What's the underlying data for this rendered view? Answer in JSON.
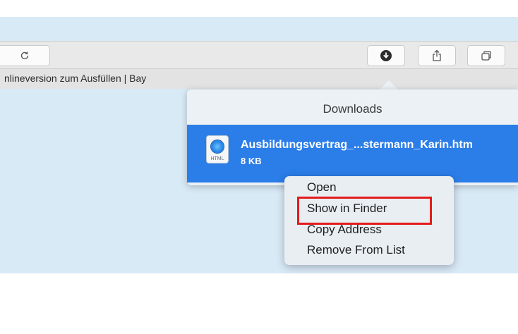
{
  "toolbar": {
    "reload_icon": "reload-icon",
    "download_icon": "download-icon",
    "share_icon": "share-icon",
    "tabs_icon": "tabs-icon"
  },
  "tab": {
    "title": "nlineversion zum Ausfüllen | Bay"
  },
  "downloads_popover": {
    "title": "Downloads",
    "item": {
      "file_type": "HTML",
      "name": "Ausbildungsvertrag_...stermann_Karin.htm",
      "size": "8 KB"
    }
  },
  "context_menu": {
    "items": [
      "Open",
      "Show in Finder",
      "Copy Address",
      "Remove From List"
    ],
    "highlighted": "Show in Finder"
  },
  "colors": {
    "accent": "#2b7de8",
    "highlight_border": "#e31b1b",
    "background_blue": "#d9eaf7"
  }
}
